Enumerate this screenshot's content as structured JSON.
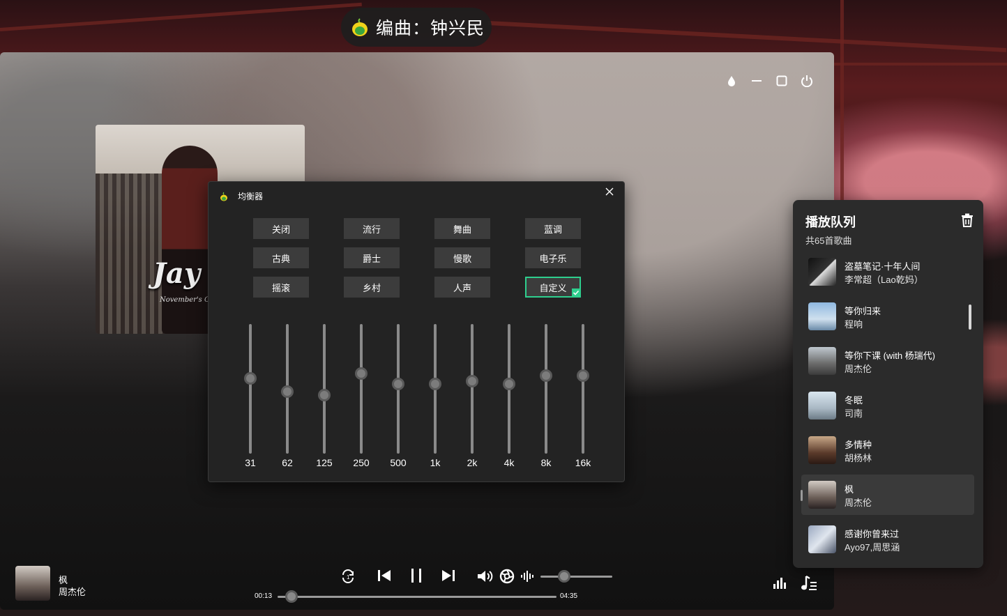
{
  "toast": {
    "text": "编曲：钟兴民"
  },
  "equalizer": {
    "title": "均衡器",
    "presets": [
      "关闭",
      "流行",
      "舞曲",
      "蓝调",
      "古典",
      "爵士",
      "慢歌",
      "电子乐",
      "摇滚",
      "乡村",
      "人声",
      "自定义"
    ],
    "active_preset": "自定义",
    "bands": [
      {
        "label": "31",
        "level": 0.42
      },
      {
        "label": "62",
        "level": 0.52
      },
      {
        "label": "125",
        "level": 0.55
      },
      {
        "label": "250",
        "level": 0.38
      },
      {
        "label": "500",
        "level": 0.46
      },
      {
        "label": "1k",
        "level": 0.46
      },
      {
        "label": "2k",
        "level": 0.44
      },
      {
        "label": "4k",
        "level": 0.46
      },
      {
        "label": "8k",
        "level": 0.4
      },
      {
        "label": "16k",
        "level": 0.4
      }
    ],
    "accent": "#2ecf8e"
  },
  "queue": {
    "title": "播放队列",
    "count": "共65首歌曲",
    "items": [
      {
        "song": "盗墓笔记·十年人间",
        "artist": "李常超（Lao乾妈）",
        "current": false
      },
      {
        "song": "等你归来",
        "artist": "程响",
        "current": false
      },
      {
        "song": "等你下课 (with 杨瑞代)",
        "artist": "周杰伦",
        "current": false
      },
      {
        "song": "冬眠",
        "artist": "司南",
        "current": false
      },
      {
        "song": "多情种",
        "artist": "胡杨林",
        "current": false
      },
      {
        "song": "枫",
        "artist": "周杰伦",
        "current": true
      },
      {
        "song": "感谢你曾来过",
        "artist": "Ayo97,周思涵",
        "current": false
      }
    ]
  },
  "player": {
    "song": "枫",
    "artist": "周杰伦",
    "time_current": "00:13",
    "time_total": "04:35",
    "progress": 0.05,
    "volume": 0.33
  },
  "album": {
    "title": "Jay Chou",
    "subtitle": "November's Chopin"
  }
}
